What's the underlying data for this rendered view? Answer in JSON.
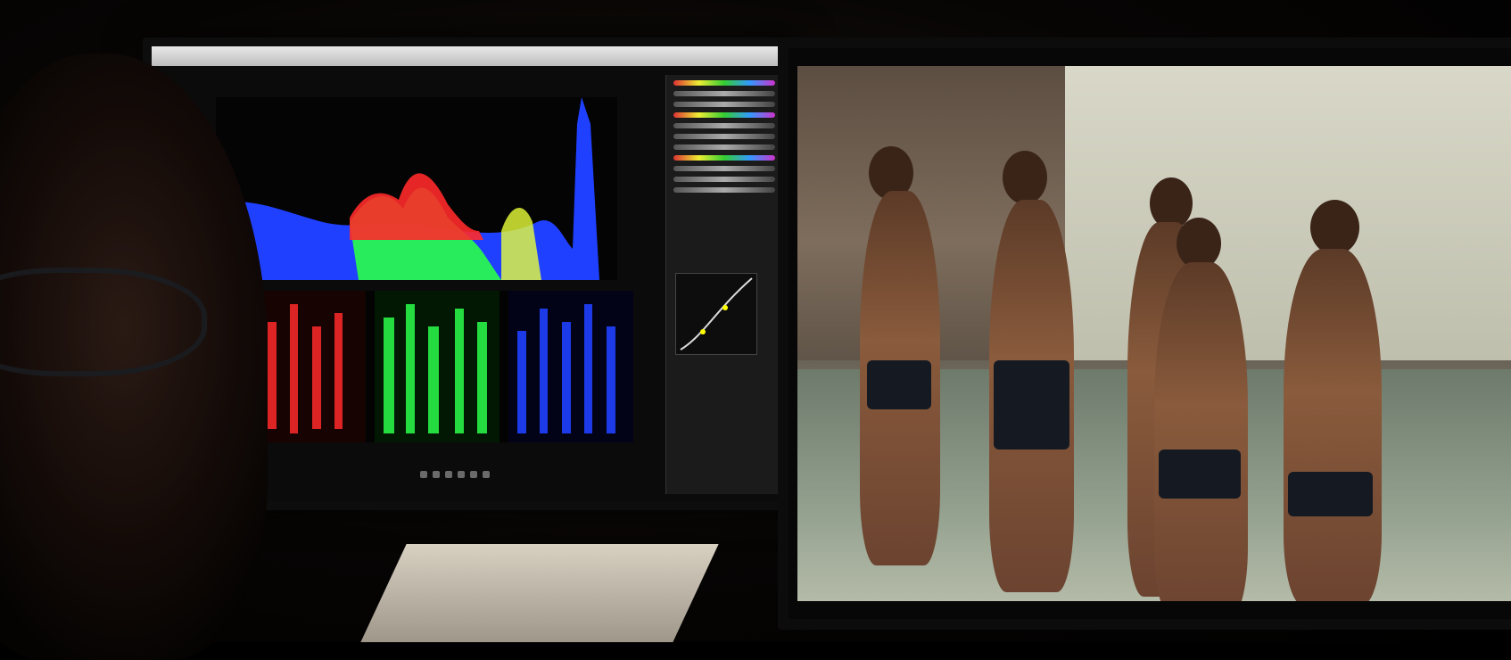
{
  "scene": {
    "description_colors": {
      "histogram_red": "#ff2a2a",
      "histogram_green": "#2aff4a",
      "histogram_blue": "#2040ff",
      "menubar": "#d8d8d8"
    },
    "icons": [
      "play-icon",
      "pause-icon",
      "rewind-icon",
      "forward-icon"
    ]
  }
}
